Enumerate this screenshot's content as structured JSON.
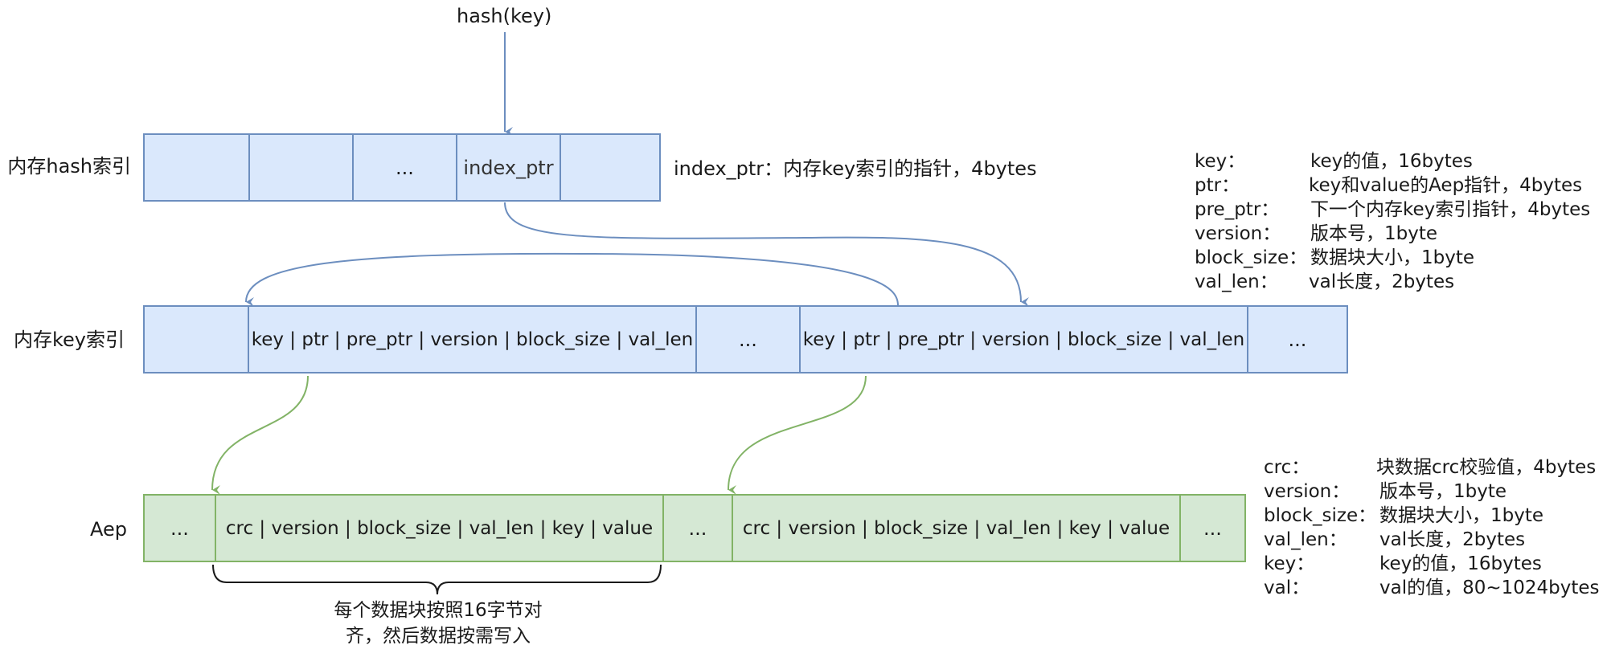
{
  "hash_label": "hash(key)",
  "rows": {
    "hash_index": {
      "label": "内存hash索引",
      "cells": [
        "",
        "",
        "...",
        "index_ptr",
        ""
      ],
      "note": "index_ptr：内存key索引的指针，4bytes"
    },
    "key_index": {
      "label": "内存key索引",
      "cells": [
        "",
        "key | ptr | pre_ptr | version | block_size | val_len",
        "...",
        "key | ptr | pre_ptr | version | block_size | val_len",
        "..."
      ]
    },
    "aep": {
      "label": "Aep",
      "cells": [
        "...",
        "crc | version | block_size | val_len | key | value",
        "...",
        "crc | version | block_size | val_len | key | value",
        "..."
      ]
    }
  },
  "key_legend": [
    {
      "key": "key：",
      "desc": "key的值，16bytes"
    },
    {
      "key": "ptr：",
      "desc": "key和value的Aep指针，4bytes"
    },
    {
      "key": "pre_ptr：",
      "desc": "下一个内存key索引指针，4bytes"
    },
    {
      "key": "version：",
      "desc": "版本号，1byte"
    },
    {
      "key": "block_size：",
      "desc": "数据块大小，1byte"
    },
    {
      "key": "val_len：",
      "desc": "val长度，2bytes"
    }
  ],
  "aep_legend": [
    {
      "key": "crc：",
      "desc": "块数据crc校验值，4bytes"
    },
    {
      "key": "version：",
      "desc": "版本号，1byte"
    },
    {
      "key": "block_size：",
      "desc": "数据块大小，1byte"
    },
    {
      "key": "val_len：",
      "desc": "val长度，2bytes"
    },
    {
      "key": "key：",
      "desc": "key的值，16bytes"
    },
    {
      "key": "val：",
      "desc": "val的值，80~1024bytes"
    }
  ],
  "brace_note": {
    "line1": "每个数据块按照16字节对",
    "line2": "齐，然后数据按需写入"
  },
  "colors": {
    "blue_fill": "#dae8fc",
    "blue_stroke": "#6c8ebf",
    "green_fill": "#d5e8d4",
    "green_stroke": "#82b366"
  }
}
